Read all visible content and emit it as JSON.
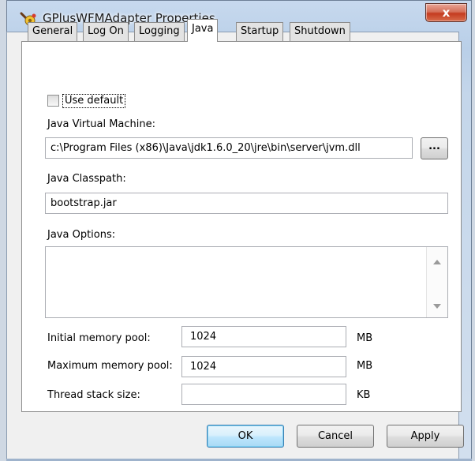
{
  "window": {
    "title": "GPlusWFMAdapter Properties",
    "close_glyph": "x"
  },
  "tabs": [
    {
      "label": "General",
      "active": false
    },
    {
      "label": "Log On",
      "active": false
    },
    {
      "label": "Logging",
      "active": false
    },
    {
      "label": "Java",
      "active": true
    },
    {
      "label": "Startup",
      "active": false
    },
    {
      "label": "Shutdown",
      "active": false
    }
  ],
  "java": {
    "use_default": {
      "label": "Use default",
      "checked": false
    },
    "jvm": {
      "label": "Java Virtual Machine:",
      "value": "c:\\Program Files (x86)\\Java\\jdk1.6.0_20\\jre\\bin\\server\\jvm.dll",
      "browse_label": "..."
    },
    "classpath": {
      "label": "Java Classpath:",
      "value": "bootstrap.jar"
    },
    "options": {
      "label": "Java Options:",
      "value": ""
    },
    "initial_memory": {
      "label": "Initial memory pool:",
      "value": "1024",
      "unit": "MB"
    },
    "max_memory": {
      "label": "Maximum memory pool:",
      "value": "1024",
      "unit": "MB"
    },
    "thread_stack": {
      "label": "Thread stack size:",
      "value": "",
      "unit": "KB"
    }
  },
  "buttons": {
    "ok": "OK",
    "cancel": "Cancel",
    "apply": "Apply"
  },
  "icons": {
    "app": "service-icon",
    "close": "close-icon",
    "scroll_up": "scroll-up-arrow-icon",
    "scroll_down": "scroll-down-arrow-icon"
  },
  "colors": {
    "titlebar": "#b9cfe8",
    "close": "#c43b1f",
    "default_button": "#a7d9f5"
  }
}
